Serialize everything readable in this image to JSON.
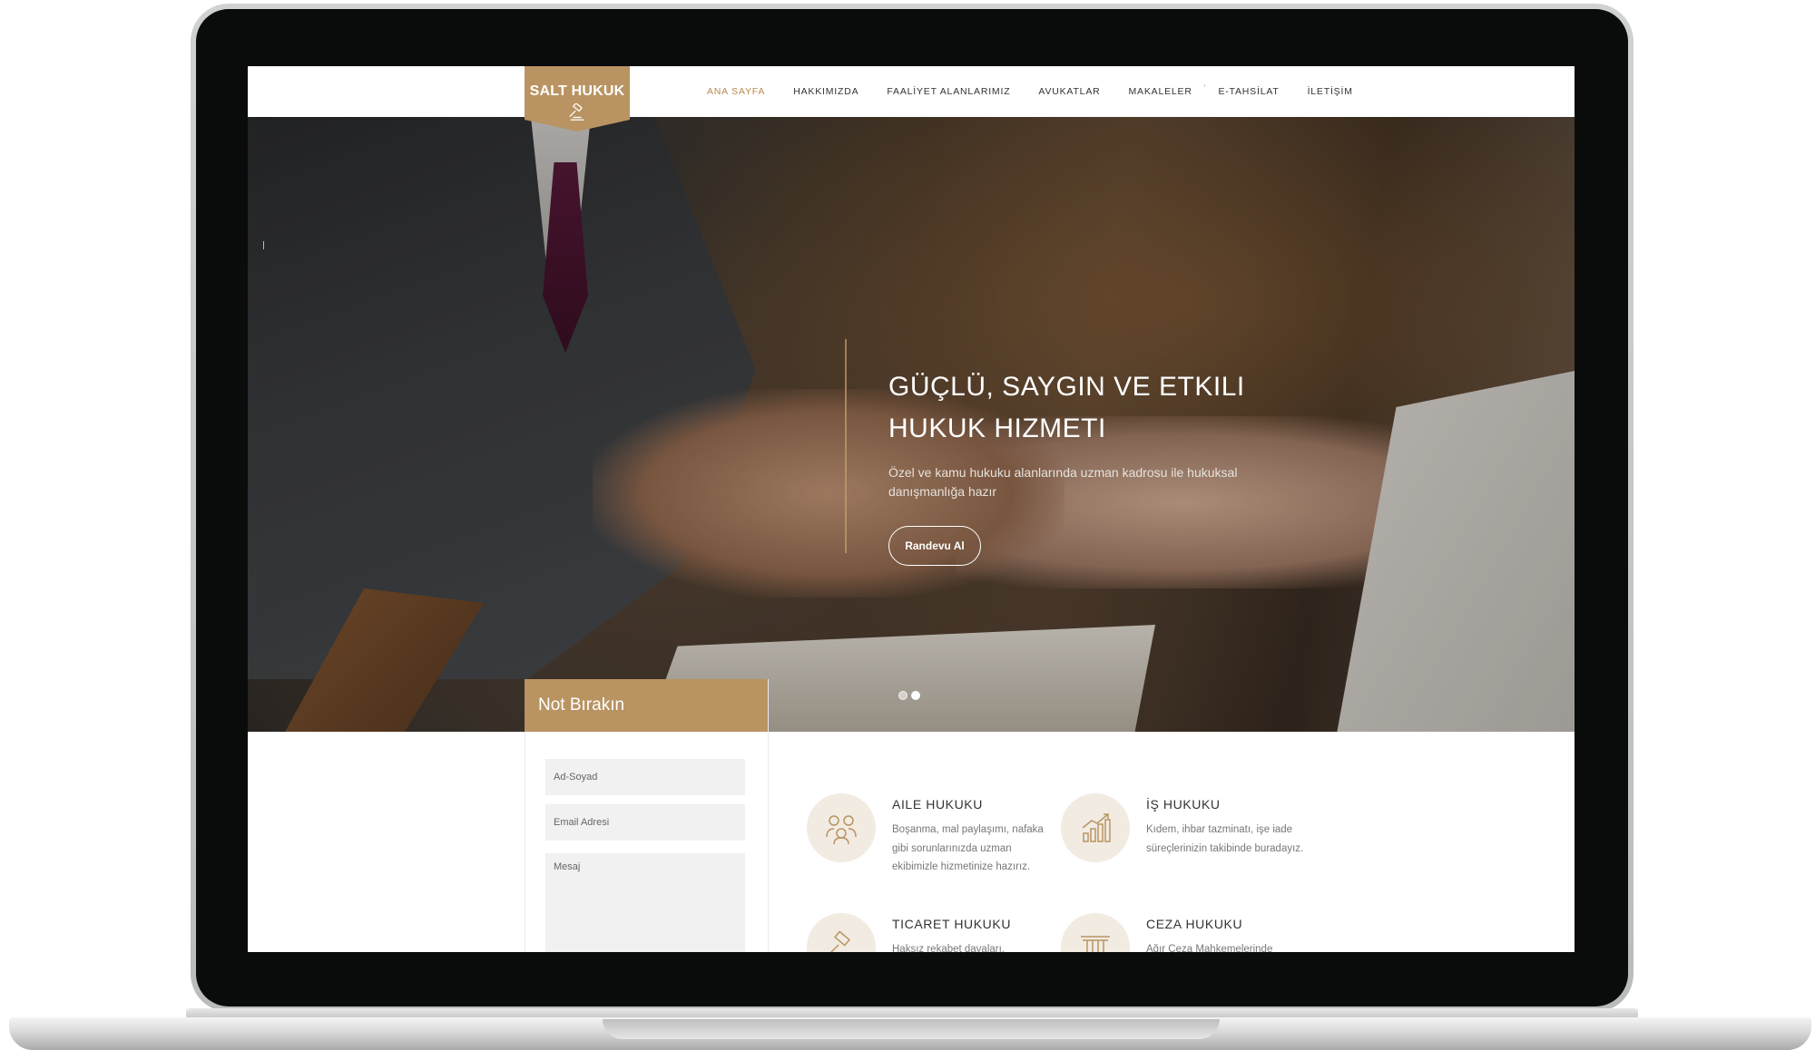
{
  "brand": {
    "name": "SALT HUKUK",
    "accent_color": "#b99462",
    "icon": "gavel-icon"
  },
  "nav": {
    "items": [
      {
        "label": "ANA SAYFA",
        "active": true
      },
      {
        "label": "HAKKIMIZDA",
        "active": false
      },
      {
        "label": "FAALİYET ALANLARIMIZ",
        "active": false
      },
      {
        "label": "AVUKATLAR",
        "active": false
      },
      {
        "label": "MAKALELER",
        "active": false
      },
      {
        "label": "E-TAHSİLAT",
        "active": false
      },
      {
        "label": "İLETİŞİM",
        "active": false
      }
    ],
    "separator": "'"
  },
  "hero": {
    "title_line1": "GÜÇLÜ, SAYGIN VE ETKILI",
    "title_line2": "HUKUK HIZMETI",
    "subtitle": "Özel ve kamu hukuku alanlarında uzman kadrosu ile hukuksal danışmanlığa hazır",
    "button_label": "Randevu Al",
    "slides_total": 2,
    "active_slide": 2
  },
  "note_form": {
    "title": "Not Bırakın",
    "name_placeholder": "Ad-Soyad",
    "email_placeholder": "Email Adresi",
    "message_placeholder": "Mesaj"
  },
  "services": [
    {
      "title": "AILE HUKUKU",
      "text": "Boşanma, mal paylaşımı, nafaka gibi sorunlarınızda uzman ekibimizle hizmetinize hazırız.",
      "icon": "family-icon"
    },
    {
      "title": "İŞ HUKUKU",
      "text": "Kıdem, ihbar tazminatı, işe iade süreçlerinizin takibinde buradayız.",
      "icon": "growth-chart-icon"
    },
    {
      "title": "TICARET HUKUKU",
      "text": "Haksız rekabet davaları,",
      "icon": "gavel-icon"
    },
    {
      "title": "CEZA HUKUKU",
      "text": "Ağır Ceza Mahkemelerinde",
      "icon": "courthouse-icon"
    }
  ]
}
